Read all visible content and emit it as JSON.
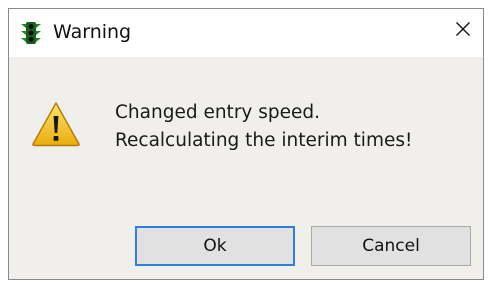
{
  "window": {
    "title": "Warning",
    "title_icon": "traffic-light-icon",
    "close_icon": "close-icon"
  },
  "message": {
    "icon": "warning-triangle-icon",
    "line1": "Changed entry speed.",
    "line2": "Recalculating the interim times!"
  },
  "buttons": {
    "ok_label": "Ok",
    "cancel_label": "Cancel"
  },
  "colors": {
    "focus_border": "#2f7fd8",
    "warning_yellow": "#f3c41b",
    "traffic_light_green": "#1c8a2a"
  }
}
